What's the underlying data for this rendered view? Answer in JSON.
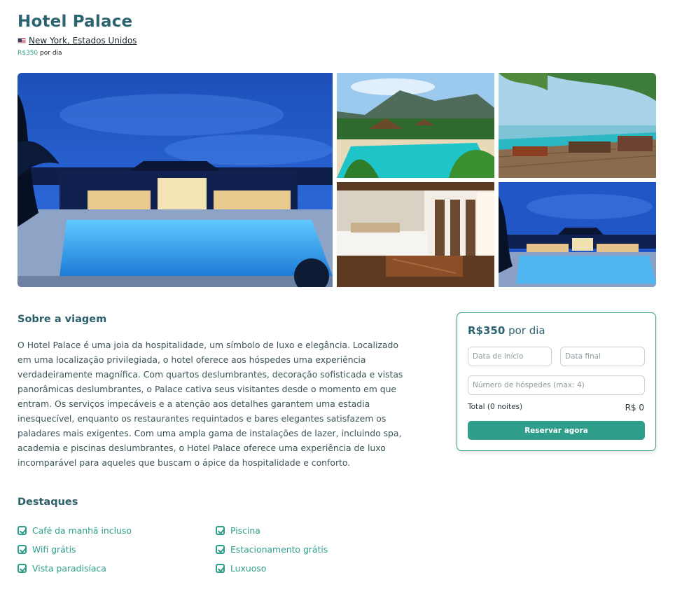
{
  "hotel": {
    "name": "Hotel Palace",
    "location": "New York, Estados Unidos",
    "price_amount": "R$350",
    "price_unit": "por dia"
  },
  "gallery": {
    "images": [
      {
        "name": "pool-night-large"
      },
      {
        "name": "tropical-pool"
      },
      {
        "name": "deck-infinity-pool"
      },
      {
        "name": "bedroom"
      },
      {
        "name": "pool-night-small"
      }
    ]
  },
  "about": {
    "title": "Sobre a viagem",
    "text": "O Hotel Palace é uma joia da hospitalidade, um símbolo de luxo e elegância. Localizado em uma localização privilegiada, o hotel oferece aos hóspedes uma experiência verdadeiramente magnífica. Com quartos deslumbrantes, decoração sofisticada e vistas panorâmicas deslumbrantes, o Palace cativa seus visitantes desde o momento em que entram. Os serviços impecáveis e a atenção aos detalhes garantem uma estadia inesquecível, enquanto os restaurantes requintados e bares elegantes satisfazem os paladares mais exigentes. Com uma ampla gama de instalações de lazer, incluindo spa, academia e piscinas deslumbrantes, o Hotel Palace oferece uma experiência de luxo incomparável para aqueles que buscam o ápice da hospitalidade e conforto."
  },
  "booking": {
    "price_amount": "R$350",
    "price_unit": "por dia",
    "start_placeholder": "Data de início",
    "end_placeholder": "Data final",
    "guests_placeholder": "Número de hóspedes (max: 4)",
    "total_label": "Total (0 noites)",
    "total_value": "R$ 0",
    "button_label": "Reservar agora"
  },
  "highlights": {
    "title": "Destaques",
    "items": [
      {
        "label": "Café da manhã incluso",
        "icon": "check-square-icon"
      },
      {
        "label": "Piscina",
        "icon": "check-square-icon"
      },
      {
        "label": "Wifi grátis",
        "icon": "check-square-icon"
      },
      {
        "label": "Estacionamento grátis",
        "icon": "check-square-icon"
      },
      {
        "label": "Vista paradisíaca",
        "icon": "check-square-icon"
      },
      {
        "label": "Luxuoso",
        "icon": "check-square-icon"
      }
    ]
  },
  "colors": {
    "accent": "#2e9e8a",
    "heading": "#2b6470"
  }
}
